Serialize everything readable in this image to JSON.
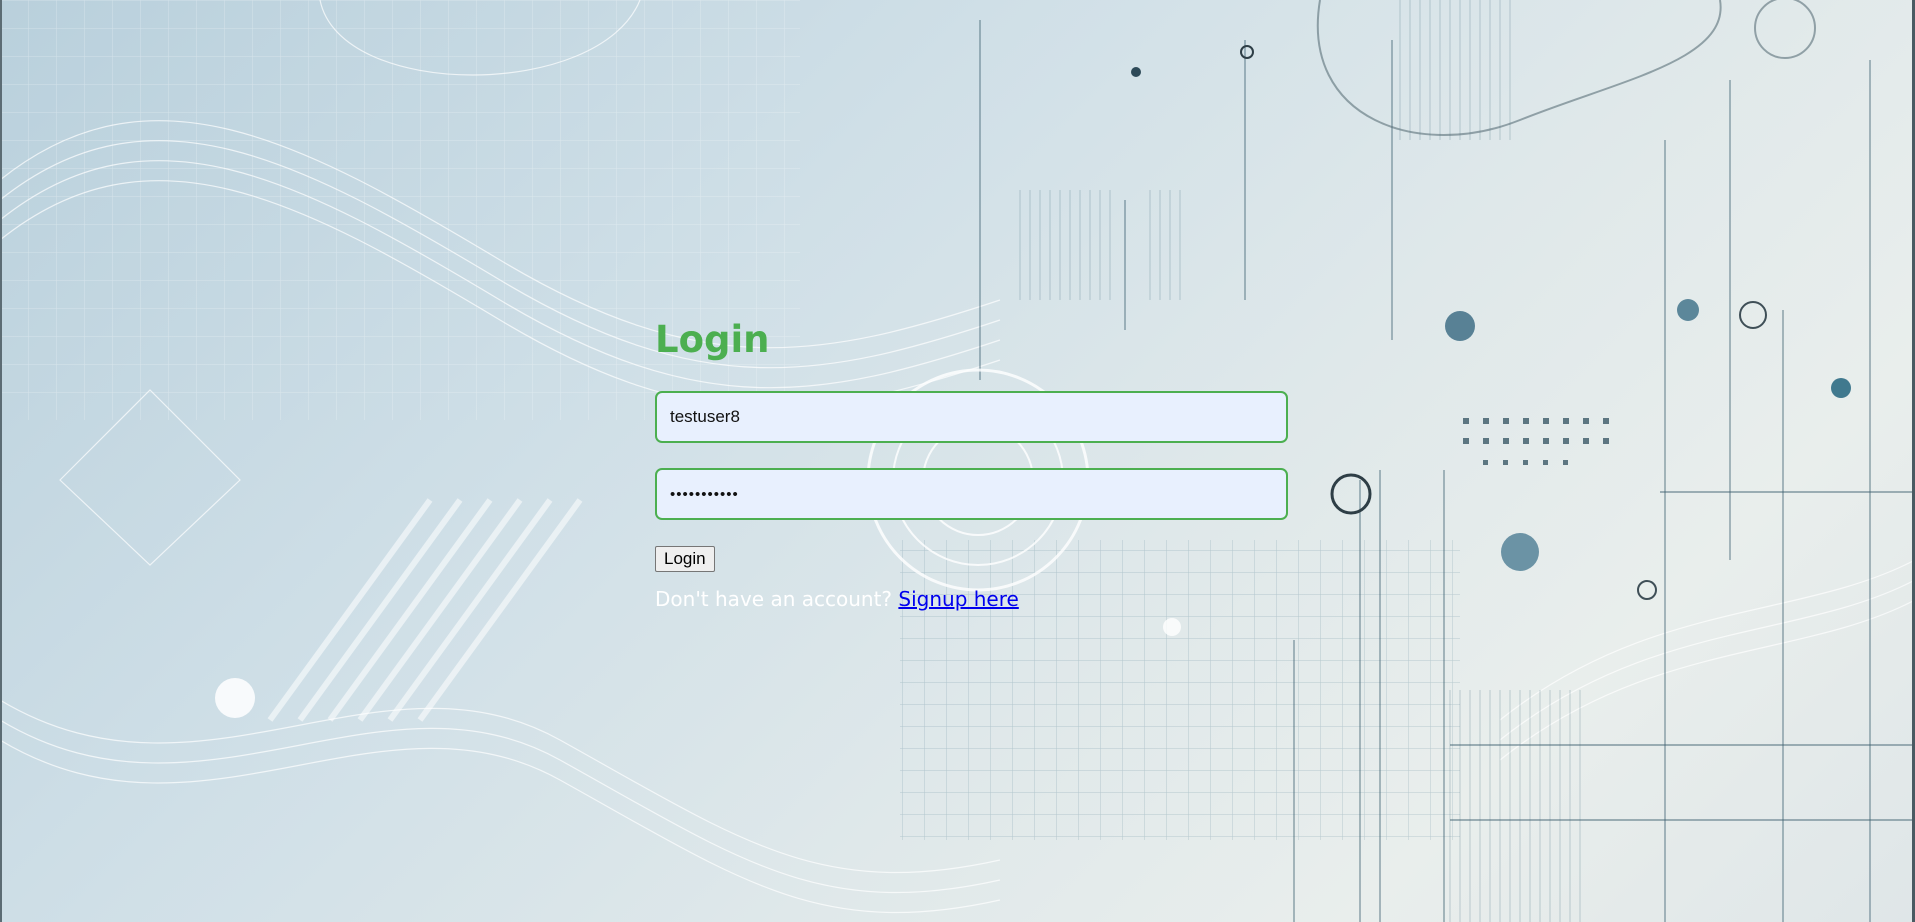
{
  "login": {
    "title": "Login",
    "username_value": "testuser8",
    "password_value": "testpass8ab",
    "button_label": "Login",
    "signup_prompt": "Don't have an account?",
    "signup_link": "Signup here"
  },
  "colors": {
    "accent": "#4caf50",
    "input_background": "#e8f0fe",
    "link": "#0000ee"
  }
}
